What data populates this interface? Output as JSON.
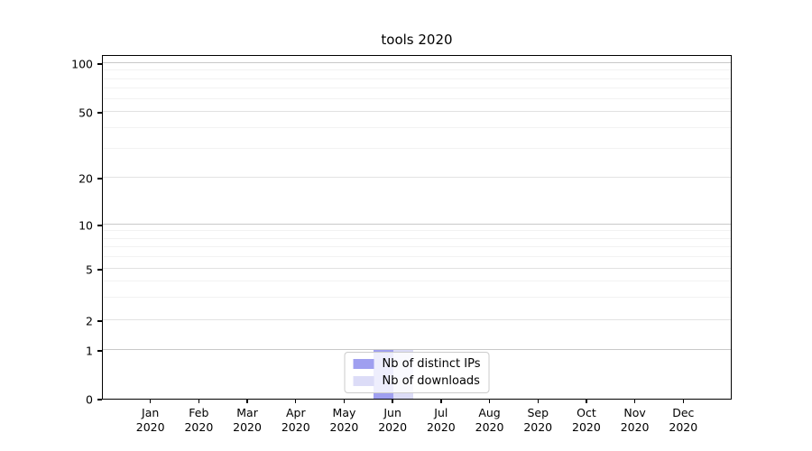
{
  "title": "tools 2020",
  "chart_data": {
    "type": "bar",
    "title": "tools 2020",
    "categories": [
      "Jan",
      "Feb",
      "Mar",
      "Apr",
      "May",
      "Jun",
      "Jul",
      "Aug",
      "Sep",
      "Oct",
      "Nov",
      "Dec"
    ],
    "x_year": "2020",
    "series": [
      {
        "name": "Nb of distinct IPs",
        "color": "#9f9ff0",
        "values": [
          0,
          0,
          0,
          0,
          0,
          1,
          0,
          0,
          0,
          0,
          0,
          0
        ]
      },
      {
        "name": "Nb of downloads",
        "color": "#dcdcf7",
        "values": [
          0,
          0,
          0,
          0,
          0,
          1,
          0,
          0,
          0,
          0,
          0,
          0
        ]
      }
    ],
    "y_axis": {
      "scale": "symlog-like",
      "ticks": [
        {
          "label": "0",
          "value": 0,
          "frac": 0.0,
          "strong": false
        },
        {
          "label": "1",
          "value": 1,
          "frac": 0.141,
          "strong": true
        },
        {
          "label": "2",
          "value": 2,
          "frac": 0.228,
          "strong": false
        },
        {
          "label": "5",
          "value": 5,
          "frac": 0.377,
          "strong": false
        },
        {
          "label": "10",
          "value": 10,
          "frac": 0.505,
          "strong": true
        },
        {
          "label": "20",
          "value": 20,
          "frac": 0.641,
          "strong": false
        },
        {
          "label": "50",
          "value": 50,
          "frac": 0.832,
          "strong": false
        },
        {
          "label": "100",
          "value": 100,
          "frac": 0.974,
          "strong": true
        }
      ],
      "minor_fracs": [
        0.294,
        0.341,
        0.411,
        0.439,
        0.464,
        0.486,
        0.726,
        0.786,
        0.869,
        0.901,
        0.928,
        0.952
      ]
    },
    "legend": {
      "position": "lower center",
      "entries": [
        "Nb of distinct IPs",
        "Nb of downloads"
      ]
    },
    "grid": true,
    "xlabel": "",
    "ylabel": ""
  }
}
